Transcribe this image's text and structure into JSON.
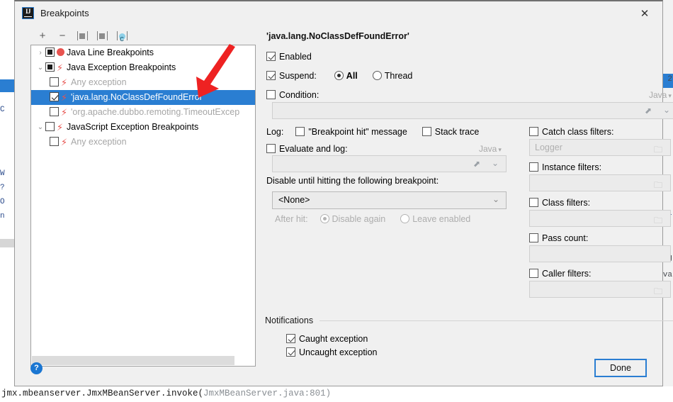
{
  "window": {
    "title": "Breakpoints",
    "icon": "intellij-idea-icon",
    "close_label": "✕"
  },
  "background": {
    "left_code_lines": [
      "C",
      "W",
      "?",
      "O",
      "n"
    ],
    "right_text": [
      "2",
      "ur",
      "ag",
      "va"
    ],
    "console_line_main": "jmx.mbeanserver.JmxMBeanServer.invoke(",
    "console_line_dim": "JmxMBeanServer.java:801)"
  },
  "toolbar": {
    "buttons": [
      {
        "name": "add-breakpoint-button",
        "glyph": "+"
      },
      {
        "name": "remove-breakpoint-button",
        "glyph": "−"
      },
      {
        "name": "group-by-file-icon",
        "glyph": ""
      },
      {
        "name": "save-breakpoints-icon",
        "glyph": ""
      },
      {
        "name": "group-by-class-icon",
        "glyph": "C"
      }
    ]
  },
  "tree": {
    "items": [
      {
        "label": "Java Line Breakpoints",
        "arrow": "›",
        "checkbox": "filled",
        "marker": "dot",
        "indent": 0,
        "selected": false,
        "muted": false
      },
      {
        "label": "Java Exception Breakpoints",
        "arrow": "⌄",
        "checkbox": "filled",
        "marker": "bolt",
        "indent": 0,
        "selected": false,
        "muted": false
      },
      {
        "label": "Any exception",
        "arrow": "",
        "checkbox": "empty",
        "marker": "bolt",
        "indent": 1,
        "selected": false,
        "muted": true
      },
      {
        "label": "'java.lang.NoClassDefFoundError'",
        "arrow": "",
        "checkbox": "check",
        "marker": "bolt",
        "indent": 1,
        "selected": true,
        "muted": false
      },
      {
        "label": "'org.apache.dubbo.remoting.TimeoutExcep",
        "arrow": "",
        "checkbox": "empty",
        "marker": "bolt",
        "indent": 1,
        "selected": false,
        "muted": true
      },
      {
        "label": "JavaScript Exception Breakpoints",
        "arrow": "⌄",
        "checkbox": "empty",
        "marker": "bolt",
        "indent": 0,
        "selected": false,
        "muted": false
      },
      {
        "label": "Any exception",
        "arrow": "",
        "checkbox": "empty",
        "marker": "bolt",
        "indent": 1,
        "selected": false,
        "muted": true
      }
    ]
  },
  "details": {
    "title": "'java.lang.NoClassDefFoundError'",
    "enabled": {
      "label": "Enabled",
      "checked": true
    },
    "suspend": {
      "label": "Suspend:",
      "checked": true,
      "options": [
        {
          "label": "All",
          "selected": true
        },
        {
          "label": "Thread",
          "selected": false
        }
      ]
    },
    "condition": {
      "label": "Condition:",
      "checked": false,
      "value": "",
      "language": "Java"
    },
    "log": {
      "label": "Log:",
      "breakpoint_hit": {
        "label": "\"Breakpoint hit\" message",
        "checked": false
      },
      "stack_trace": {
        "label": "Stack trace",
        "checked": false
      }
    },
    "evaluate_and_log": {
      "label": "Evaluate and log:",
      "checked": false,
      "value": "",
      "language": "Java"
    },
    "disable_until": {
      "label": "Disable until hitting the following breakpoint:",
      "value": "<None>",
      "after_hit_label": "After hit:",
      "options": [
        {
          "label": "Disable again",
          "selected": true
        },
        {
          "label": "Leave enabled",
          "selected": false
        }
      ]
    },
    "filters": [
      {
        "label": "Catch class filters:",
        "checked": false,
        "value": "",
        "placeholder": "Logger",
        "has_folder": true
      },
      {
        "label": "Instance filters:",
        "checked": false,
        "value": "",
        "placeholder": "",
        "has_folder": true
      },
      {
        "label": "Class filters:",
        "checked": false,
        "value": "",
        "placeholder": "",
        "has_folder": true
      },
      {
        "label": "Pass count:",
        "checked": false,
        "value": "",
        "placeholder": "",
        "has_folder": false
      },
      {
        "label": "Caller filters:",
        "checked": false,
        "value": "",
        "placeholder": "",
        "has_folder": true
      }
    ],
    "notifications": {
      "title": "Notifications",
      "caught": {
        "label": "Caught exception",
        "checked": true
      },
      "uncaught": {
        "label": "Uncaught exception",
        "checked": true
      }
    }
  },
  "footer": {
    "help_label": "?",
    "done_label": "Done"
  },
  "annotation": {
    "type": "red-arrow",
    "color": "#ee2222"
  }
}
